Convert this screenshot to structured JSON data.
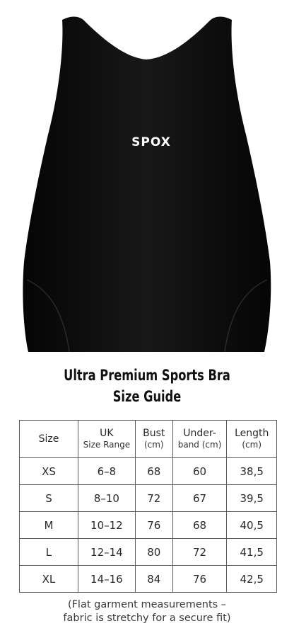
{
  "product": {
    "brand_logo_text": "SPOX",
    "image": "black-crop-sports-bra"
  },
  "title": {
    "line1": "Ultra Premium Sports Bra",
    "line2": "Size Guide"
  },
  "table": {
    "headers": [
      {
        "top": "Size",
        "bottom": ""
      },
      {
        "top": "UK",
        "bottom": "Size Range"
      },
      {
        "top": "Bust",
        "bottom": "(cm)"
      },
      {
        "top": "Under-",
        "bottom": "band (cm)"
      },
      {
        "top": "Length",
        "bottom": "(cm)"
      }
    ],
    "rows": [
      [
        "XS",
        "6–8",
        "68",
        "60",
        "38,5"
      ],
      [
        "S",
        "8–10",
        "72",
        "67",
        "39,5"
      ],
      [
        "M",
        "10–12",
        "76",
        "68",
        "40,5"
      ],
      [
        "L",
        "12–14",
        "80",
        "72",
        "41,5"
      ],
      [
        "XL",
        "14–16",
        "84",
        "76",
        "42,5"
      ]
    ]
  },
  "note": {
    "line1": "(Flat garment measurements –",
    "line2": "fabric is stretchy for a secure fit)"
  },
  "colors": {
    "garment": "#0d0d0d",
    "border": "#5a5a5a"
  }
}
